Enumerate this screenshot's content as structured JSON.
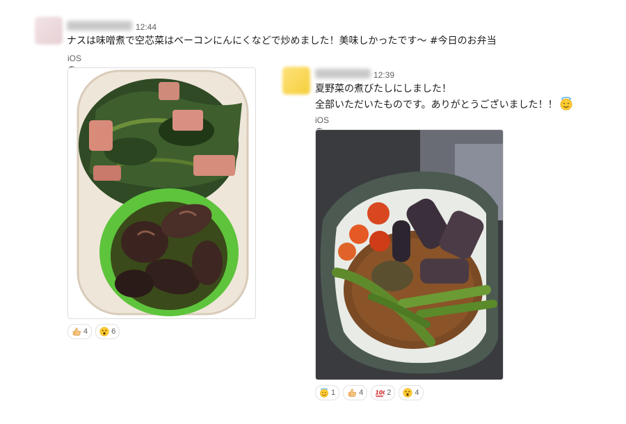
{
  "messages": [
    {
      "time": "12:44",
      "text": "ナスは味噌煮で空芯菜はベーコンにんにくなどで炒めました！美味しかったです〜 #今日のお弁当",
      "attachment_label": "iOS の画像",
      "reactions": [
        {
          "icon": "thumbs-up-icon",
          "count": "4"
        },
        {
          "icon": "astonished-face-icon",
          "count": "6"
        }
      ]
    },
    {
      "time": "12:39",
      "lines": [
        "夏野菜の煮びたしにしました！",
        "全部いただいたものです。ありがとうございました！！"
      ],
      "inline_emoji": "innocent-face-icon",
      "attachment_label": "iOS の画像",
      "reactions": [
        {
          "icon": "innocent-face-icon",
          "count": "1"
        },
        {
          "icon": "thumbs-up-icon",
          "count": "4"
        },
        {
          "icon": "hundred-points-icon",
          "count": "2"
        },
        {
          "icon": "astonished-face-icon",
          "count": "4"
        }
      ]
    }
  ],
  "colors": {
    "accent_text": "#1d1c1d",
    "meta_text": "#616061",
    "border": "#dddddd"
  }
}
